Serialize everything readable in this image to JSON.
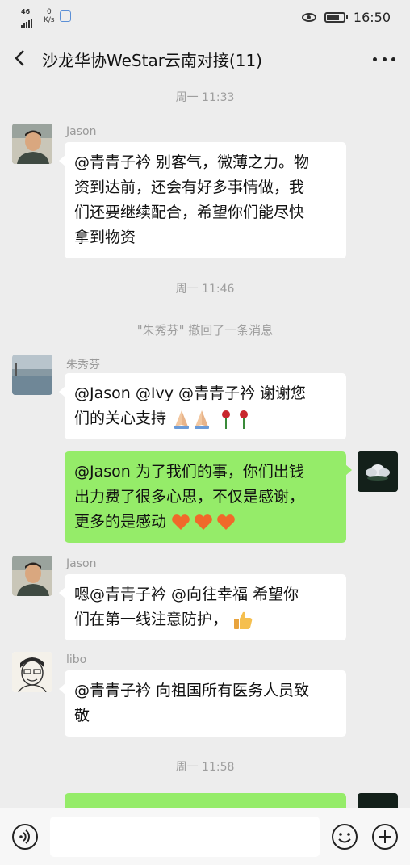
{
  "status_bar": {
    "network": "46",
    "speed_value": "0",
    "speed_unit": "K/s",
    "time": "16:50"
  },
  "header": {
    "title": "沙龙华协WeStar云南对接(11)"
  },
  "timestamps": [
    "周一 11:33",
    "周一 11:46",
    "周一 11:58"
  ],
  "system_messages": [
    "\"朱秀芬\" 撤回了一条消息"
  ],
  "messages": [
    {
      "sender": "Jason",
      "lines": [
        "@青青子衿  别客气，微薄之力。物",
        "资到达前，还会有好多事情做，我",
        "们还要继续配合，希望你们能尽快",
        "拿到物资"
      ]
    },
    {
      "sender": "朱秀芬",
      "lines": [
        "@Jason @Ivy @青青子衿  谢谢您",
        "们的关心支持"
      ]
    },
    {
      "sender": "",
      "lines": [
        "@Jason  为了我们的事，你们出钱",
        "出力费了很多心思，不仅是感谢，",
        "更多的是感动"
      ]
    },
    {
      "sender": "Jason",
      "lines": [
        "嗯@青青子衿  @向往幸福  希望你",
        "们在第一线注意防护，"
      ]
    },
    {
      "sender": "libo",
      "lines": [
        "@青青子衿  向祖国所有医务人员致",
        "敬"
      ]
    }
  ],
  "colors": {
    "background": "#ededed",
    "incoming_bubble": "#ffffff",
    "outgoing_bubble": "#95ec69",
    "meta_text": "#9e9e9e"
  },
  "icons": {
    "back": "chevron-left-icon",
    "more": "more-dots-icon",
    "voice": "voice-icon",
    "emoji": "emoji-icon",
    "plus": "plus-icon"
  }
}
